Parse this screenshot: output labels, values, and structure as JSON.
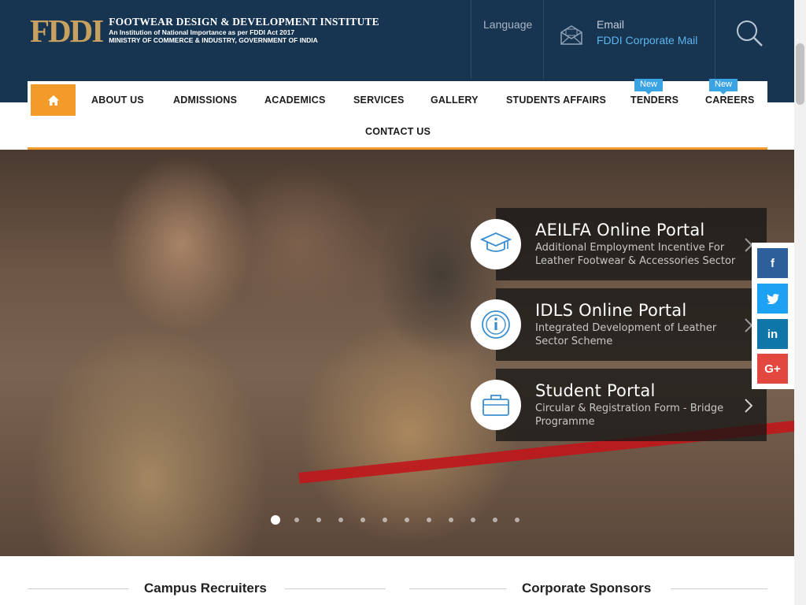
{
  "header": {
    "logo_mark": "FDDI",
    "logo_title": "FOOTWEAR DESIGN & DEVELOPMENT INSTITUTE",
    "logo_sub1": "An Institution of National Importance as per FDDI Act 2017",
    "logo_sub2": "MINISTRY OF COMMERCE & INDUSTRY, GOVERNMENT OF INDIA",
    "language_label": "Language",
    "email_label": "Email",
    "email_link": "FDDI Corporate Mail"
  },
  "nav": {
    "items": [
      {
        "label": "ABOUT US"
      },
      {
        "label": "ADMISSIONS"
      },
      {
        "label": "ACADEMICS"
      },
      {
        "label": "SERVICES"
      },
      {
        "label": "GALLERY"
      },
      {
        "label": "STUDENTS AFFAIRS"
      },
      {
        "label": "TENDERS",
        "badge": "New"
      },
      {
        "label": "CAREERS",
        "badge": "New"
      },
      {
        "label": "CONTACT US"
      }
    ]
  },
  "portals": [
    {
      "title": "AEILFA Online Portal",
      "desc": "Additional Employment Incentive For Leather Footwear & Accessories Sector",
      "icon": "graduation-cap-icon"
    },
    {
      "title": "IDLS Online Portal",
      "desc": "Integrated Development of Leather Sector Scheme",
      "icon": "info-icon"
    },
    {
      "title": "Student Portal",
      "desc": "Circular & Registration Form - Bridge Programme",
      "icon": "briefcase-icon"
    }
  ],
  "social": [
    {
      "name": "facebook",
      "glyph": "f",
      "color": "#2d5f9a"
    },
    {
      "name": "twitter",
      "glyph": "t",
      "color": "#1da1f2"
    },
    {
      "name": "linkedin",
      "glyph": "in",
      "color": "#0e76a8"
    },
    {
      "name": "google-plus",
      "glyph": "G+",
      "color": "#e2483f"
    }
  ],
  "slider": {
    "total": 12,
    "active": 1
  },
  "sections": {
    "campus_recruiters": "Campus Recruiters",
    "corporate_sponsors": "Corporate Sponsors"
  },
  "colors": {
    "header_bg": "#173451",
    "accent": "#f49a2a",
    "badge": "#3aa3e3"
  }
}
